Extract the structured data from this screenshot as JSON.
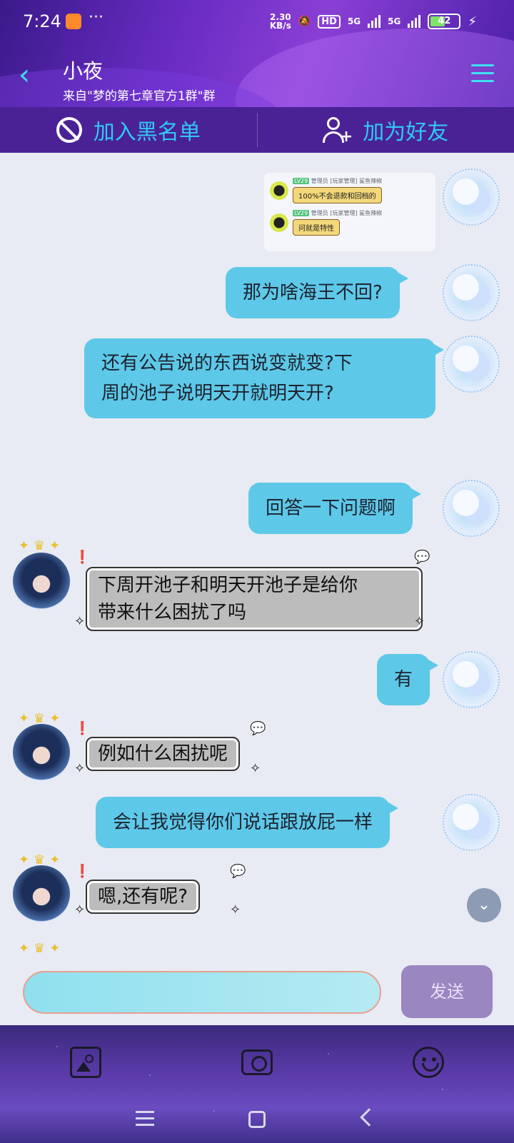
{
  "status_bar": {
    "time": "7:24",
    "more": "···",
    "net_speed_value": "2.30",
    "net_speed_unit": "KB/s",
    "hd_label": "HD",
    "signal1_label": "5G",
    "signal2_label": "5G",
    "battery": "42"
  },
  "header": {
    "name": "小夜",
    "subtitle": "来自\"梦的第七章官方1群\"群"
  },
  "actions": {
    "block_label": "加入黑名单",
    "add_friend_label": "加为好友"
  },
  "image_message": {
    "row1_level": "LV29",
    "row1_tags": "管理员 [玩家管理] 鲨鱼辣椒",
    "row1_text": "100%不会退款和回档的",
    "row2_level": "LV29",
    "row2_tags": "管理员 [玩家管理] 鲨鱼辣椒",
    "row2_text": "问就是特性"
  },
  "messages": [
    {
      "from": "me",
      "text": "那为啥海王不回?"
    },
    {
      "from": "me",
      "text_line1": "还有公告说的东西说变就变?下",
      "text_line2": "周的池子说明天开就明天开?"
    },
    {
      "from": "me",
      "text": "回答一下问题啊"
    },
    {
      "from": "other",
      "text_line1": "下周开池子和明天开池子是给你",
      "text_line2": "带来什么困扰了吗"
    },
    {
      "from": "me",
      "text": "有"
    },
    {
      "from": "other",
      "text": "例如什么困扰呢"
    },
    {
      "from": "me",
      "text": "会让我觉得你们说话跟放屁一样"
    },
    {
      "from": "other",
      "text": "嗯,还有呢?"
    }
  ],
  "input": {
    "value": "",
    "send_label": "发送"
  },
  "icons": {
    "back": "chevron-left-icon",
    "menu": "hamburger-icon",
    "block": "block-icon",
    "add_friend": "user-plus-icon",
    "scroll_down": "chevron-down-icon",
    "image": "image-icon",
    "camera": "camera-icon",
    "emoji": "smiley-icon"
  },
  "colors": {
    "my_bubble": "#5ec8e8",
    "other_bubble": "#bcbcbc",
    "action_text": "#2fc9f5",
    "header_purple": "#6a2cc4"
  }
}
